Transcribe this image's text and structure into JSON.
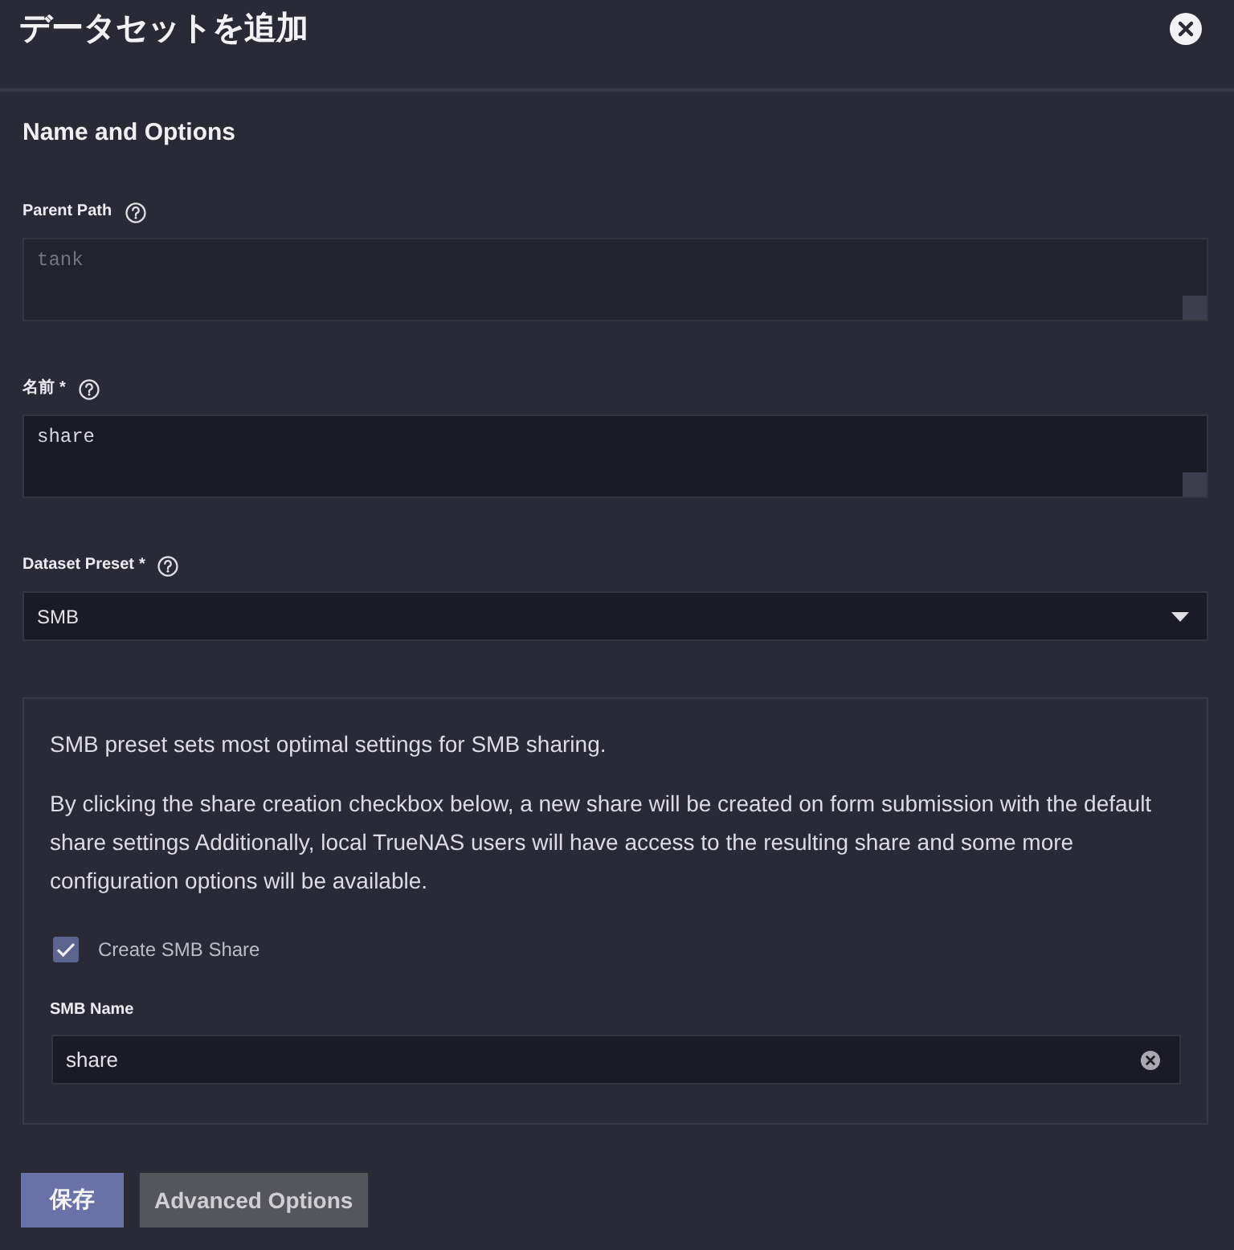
{
  "dialog": {
    "title": "データセットを追加"
  },
  "section": {
    "title": "Name and Options"
  },
  "fields": [
    {
      "kind": "textarea",
      "label": "Parent Path",
      "value": "tank",
      "disabled": true
    },
    {
      "kind": "textarea",
      "label": "名前",
      "required_mark": "*",
      "value": "share",
      "disabled": false
    },
    {
      "kind": "select",
      "label": "Dataset Preset",
      "required_mark": "*",
      "value": "SMB",
      "disabled": false
    }
  ],
  "preset_info": {
    "paragraphs": [
      "SMB preset sets most optimal settings for SMB sharing.",
      "By clicking the share creation checkbox below, a new share will be created on form submission with the default share settings Additionally, local TrueNAS users will have access to the resulting share and some more configuration options will be available."
    ],
    "checkbox": {
      "label": "Create SMB Share",
      "checked": true
    },
    "smb_name": {
      "label": "SMB Name",
      "value": "share"
    }
  },
  "buttons": [
    {
      "kind": "primary",
      "label": "保存"
    },
    {
      "kind": "secondary",
      "label": "Advanced Options"
    }
  ]
}
